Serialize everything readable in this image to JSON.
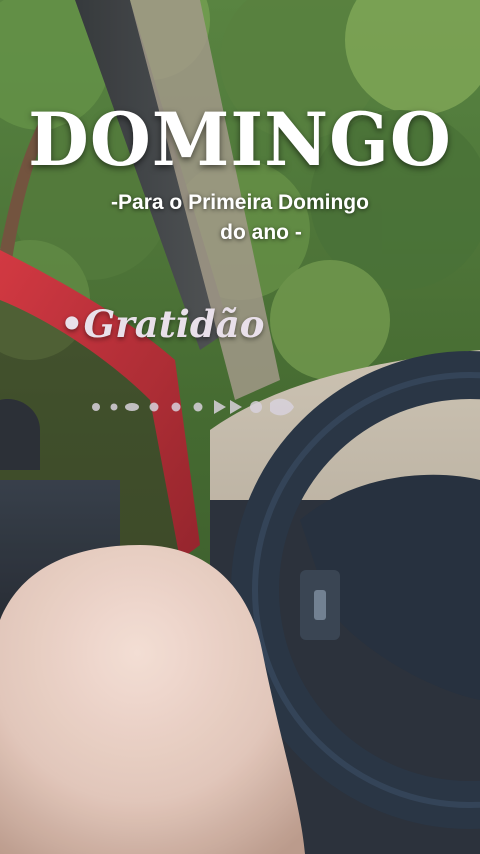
{
  "overlay": {
    "title": "DOMINGO",
    "subtitle_line1": "-Para o Primeira Domingo",
    "subtitle_line2": "do ano -",
    "tagline": "•Gratidão"
  },
  "scene": {
    "description_icon": "car-interior-photo",
    "colors": {
      "foliage": "#3f6a2c",
      "car_door": "#b5202a",
      "steering_wheel": "#1d2a3a",
      "skin": "#e6c9bb"
    }
  }
}
